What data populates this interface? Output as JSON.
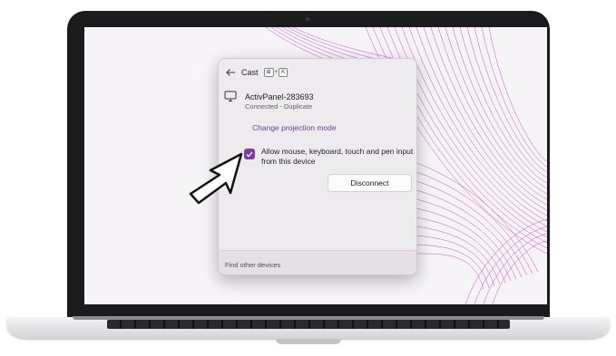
{
  "colors": {
    "accent": "#7a3f9c",
    "link": "#6c3d8a",
    "wallpaper_lines": "#c02ac0",
    "bezel": "#1b1b1d"
  },
  "cast_panel": {
    "back_icon": "back-arrow-icon",
    "title": "Cast",
    "shortcut": [
      "⊞",
      "+",
      "K"
    ],
    "device": {
      "icon": "monitor-icon",
      "name": "ActivPanel-283693",
      "status": "Connected - Duplicate"
    },
    "change_mode_link": "Change projection mode",
    "allow_input": {
      "checked": true,
      "label": "Allow mouse, keyboard, touch and pen input from this device"
    },
    "disconnect_label": "Disconnect",
    "footer_link": "Find other devices"
  },
  "annotation": {
    "icon": "cursor-arrow-icon"
  }
}
